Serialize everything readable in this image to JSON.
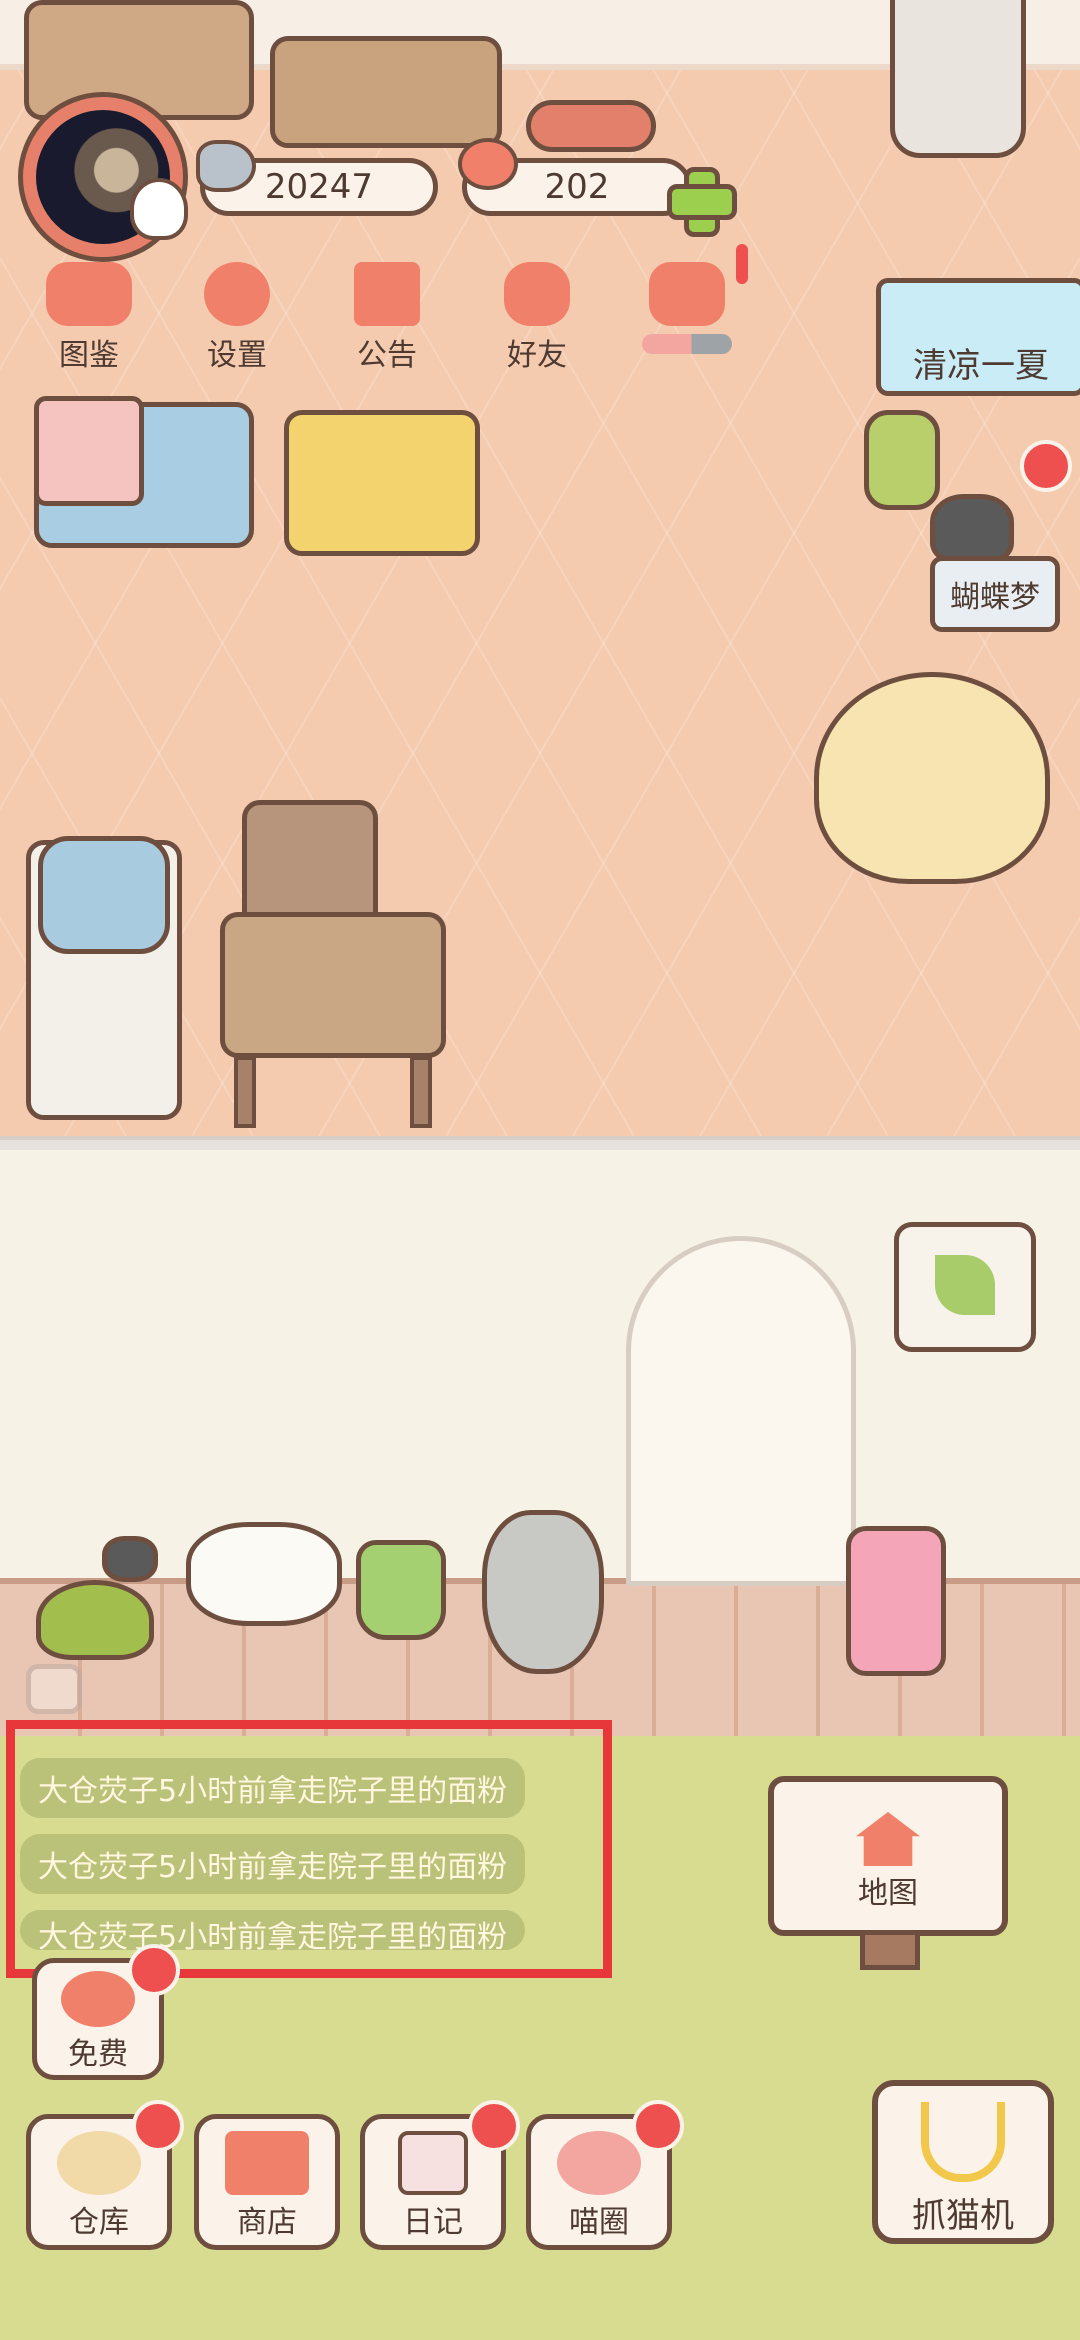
{
  "currency": {
    "fish_coins": "20247",
    "hearts": "202"
  },
  "menu": [
    {
      "label": "图鉴",
      "icon": "cat-head-icon"
    },
    {
      "label": "设置",
      "icon": "gear-icon"
    },
    {
      "label": "公告",
      "icon": "gift-icon"
    },
    {
      "label": "好友",
      "icon": "friends-icon"
    }
  ],
  "event_tag": "清凉一夏",
  "cat_tag": "蝴蝶梦",
  "news": [
    "大仓荧子5小时前拿走院子里的面粉",
    "大仓荧子5小时前拿走院子里的面粉",
    "大仓荧子5小时前拿走院子里的面粉"
  ],
  "free_label": "免费",
  "map_label": "地图",
  "bottom_nav": [
    {
      "label": "仓库",
      "icon": "bowl-icon"
    },
    {
      "label": "商店",
      "icon": "shop-icon"
    },
    {
      "label": "日记",
      "icon": "diary-icon"
    },
    {
      "label": "喵圈",
      "icon": "planet-icon"
    }
  ],
  "claw_label": "抓猫机",
  "colors": {
    "accent_red": "#ee4f4f",
    "highlight_border": "#e8373a",
    "button_pink": "#f1806a",
    "outline": "#6e4f3f"
  }
}
